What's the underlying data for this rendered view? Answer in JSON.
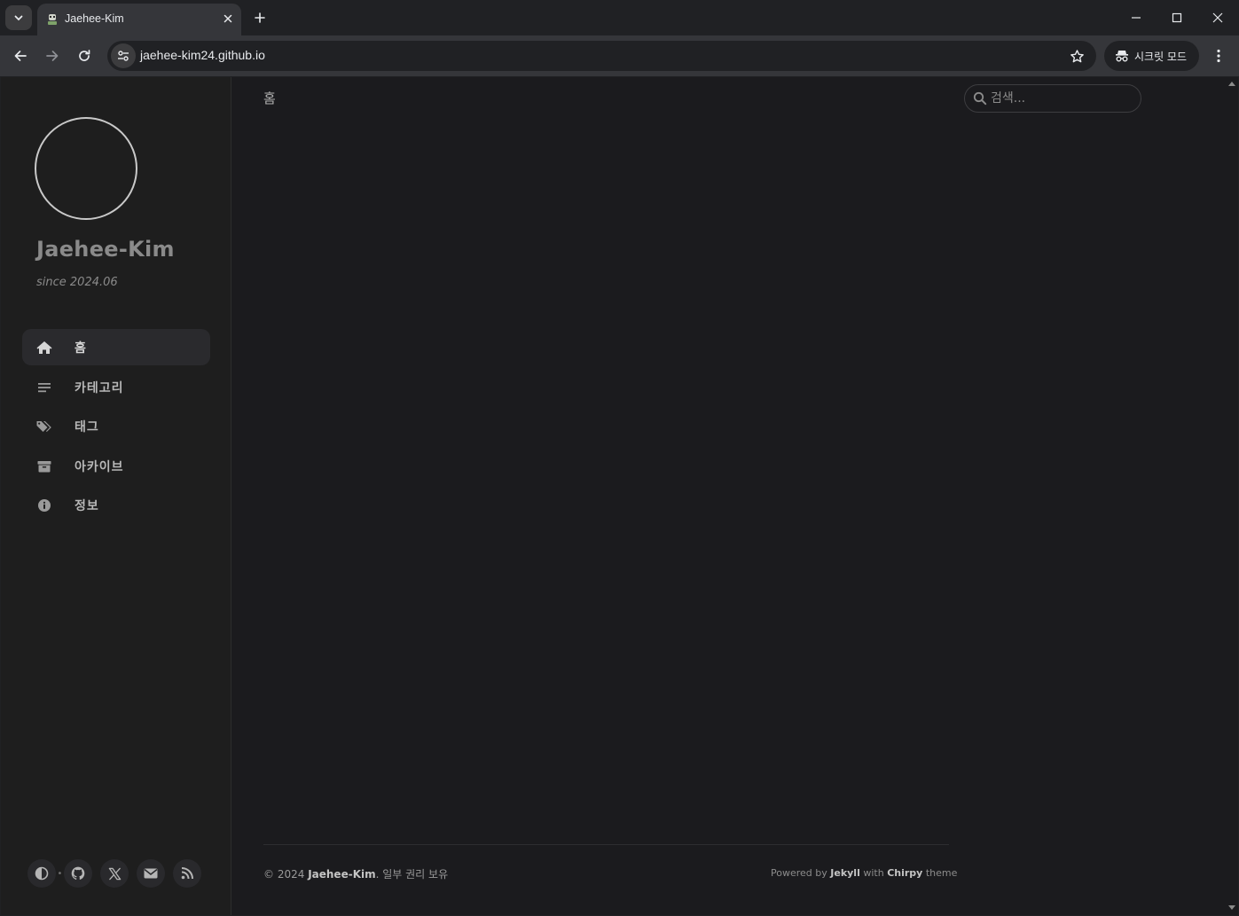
{
  "browser": {
    "tab": {
      "title": "Jaehee-Kim"
    },
    "address": {
      "url": "jaehee-kim24.github.io"
    },
    "incognito_label": "시크릿 모드",
    "icons": {
      "tab_search": "chevron-down-icon",
      "close_tab": "close-icon",
      "new_tab": "plus-icon",
      "back": "arrow-left-icon",
      "forward": "arrow-right-icon",
      "reload": "reload-icon",
      "site_info": "tune-icon",
      "bookmark": "star-icon",
      "incognito": "incognito-icon",
      "menu": "more-vertical-icon"
    }
  },
  "sidebar": {
    "title": "Jaehee-Kim",
    "subtitle": "since 2024.06",
    "nav": [
      {
        "label": "홈",
        "icon": "home-icon",
        "active": true
      },
      {
        "label": "카테고리",
        "icon": "list-icon",
        "active": false
      },
      {
        "label": "태그",
        "icon": "tags-icon",
        "active": false
      },
      {
        "label": "아카이브",
        "icon": "archive-icon",
        "active": false
      },
      {
        "label": "정보",
        "icon": "info-icon",
        "active": false
      }
    ],
    "bottom_icons": [
      "theme-toggle-icon",
      "github-icon",
      "x-twitter-icon",
      "email-icon",
      "rss-icon"
    ]
  },
  "main": {
    "breadcrumb": "홈",
    "search": {
      "placeholder": "검색..."
    }
  },
  "footer": {
    "copyright_prefix": "© 2024",
    "owner": "Jaehee-Kim",
    "rights": ". 일부 권리 보유",
    "powered_by": "Powered by",
    "engine": "Jekyll",
    "with": "with",
    "theme_name": "Chirpy",
    "theme_word": "theme"
  },
  "colors": {
    "page_bg": "#1b1b1e",
    "sidebar_bg": "#1e1e1e",
    "chrome_bg": "#202124",
    "toolbar_bg": "#35363a"
  }
}
